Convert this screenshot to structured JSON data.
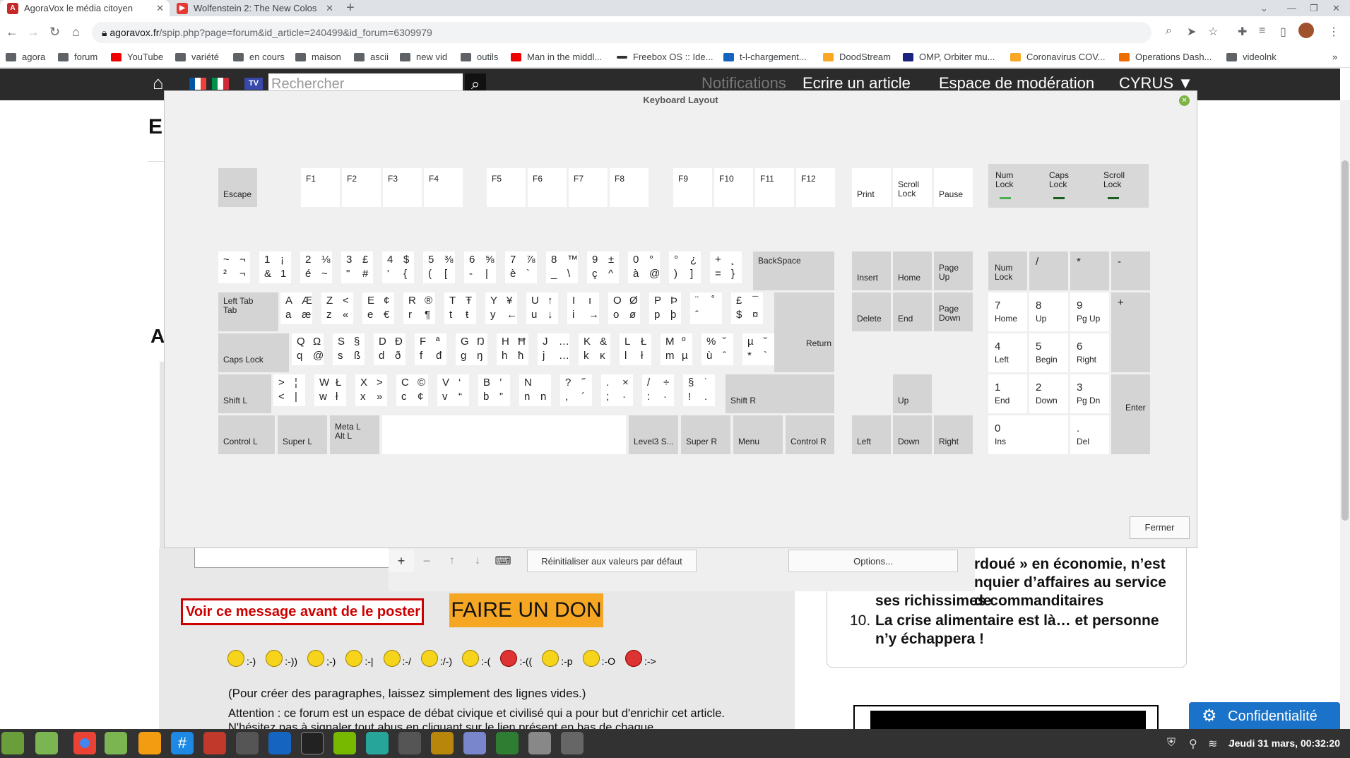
{
  "browser": {
    "tabs": [
      {
        "title": "AgoraVox le média citoyen",
        "close": "✕"
      },
      {
        "title": "Wolfenstein 2: The New Colos",
        "close": "✕"
      }
    ],
    "new_tab": "+",
    "window_controls": [
      "⌄",
      "—",
      "❐",
      "✕"
    ],
    "url_host": "agoravox.fr",
    "url_path": "/spip.php?page=forum&id_article=240499&id_forum=6309979",
    "bookmarks": [
      "agora",
      "forum",
      "YouTube",
      "variété",
      "en cours",
      "maison",
      "ascii",
      "new vid",
      "outils",
      "Man in the middl...",
      "Freebox OS :: Ide...",
      "t-l-chargement...",
      "DoodStream",
      "OMP, Orbiter mu...",
      "Coronavirus COV...",
      "Operations Dash...",
      "videolnk"
    ],
    "more_bookmarks": "»"
  },
  "site": {
    "search_placeholder": "Rechercher",
    "tv": "TV",
    "notifications": "Notifications",
    "ecrire": "Ecrire un article",
    "moderation": "Espace de modération",
    "user": "CYRUS ▼",
    "heading1": "Er",
    "heading2": "Aj",
    "voir": "Voir ce message avant de le poster",
    "don": "FAIRE UN DON",
    "smileys": [
      ":-)",
      ":-))",
      ";-)",
      ":-|",
      ":-/",
      ":/-)",
      ":-(",
      ":-((",
      ":-p",
      ":-O",
      ":->"
    ],
    "paragraph_hint": "(Pour créer des paragraphes, laissez simplement des lignes vides.)",
    "attention": "Attention : ce forum est un espace de débat civique et civilisé qui a pour but d'enrichir cet article. N'hésitez pas à signaler tout abus en cliquant sur le lien présent en bas de chaque",
    "right_panel": {
      "line1": "rdoué » en économie, n’est",
      "line2": "nquier d’affaires au service de",
      "line3": "ses richissimes commanditaires",
      "item10_num": "10.",
      "item10": "La crise alimentaire est là… et personne n’y échappera !"
    },
    "confidentialite": "Confidentialité"
  },
  "keyboard_bar": {
    "add": "+",
    "remove": "−",
    "up": "↑",
    "down": "↓",
    "reset": "Réinitialiser aux valeurs par défaut",
    "options": "Options..."
  },
  "dialog": {
    "title": "Keyboard Layout",
    "close": "Fermer",
    "fn_row": [
      "Escape",
      "F1",
      "F2",
      "F3",
      "F4",
      "F5",
      "F6",
      "F7",
      "F8",
      "F9",
      "F10",
      "F11",
      "F12"
    ],
    "sys_keys": [
      "Print",
      "Scroll\nLock",
      "Pause"
    ],
    "leds": [
      {
        "label": "Num\nLock",
        "color": "#4caf50"
      },
      {
        "label": "Caps\nLock",
        "color": "#1b5e20"
      },
      {
        "label": "Scroll\nLock",
        "color": "#1b5e20"
      }
    ],
    "row1": [
      [
        "~",
        "¬",
        "²",
        "¬"
      ],
      [
        "1",
        "¡",
        "&",
        "1"
      ],
      [
        "2",
        "⅛",
        "é",
        "~"
      ],
      [
        "3",
        "£",
        "\"",
        "#"
      ],
      [
        "4",
        "$",
        "'",
        "{"
      ],
      [
        "5",
        "⅜",
        "(",
        "["
      ],
      [
        "6",
        "⅝",
        "-",
        "|"
      ],
      [
        "7",
        "⅞",
        "è",
        "`"
      ],
      [
        "8",
        "™",
        "_",
        "\\"
      ],
      [
        "9",
        "±",
        "ç",
        "^"
      ],
      [
        "0",
        "°",
        "à",
        "@"
      ],
      [
        "°",
        "¿",
        ")",
        "]"
      ],
      [
        "+",
        "˛",
        "=",
        "}"
      ]
    ],
    "row2": [
      [
        "A",
        "Æ",
        "a",
        "æ"
      ],
      [
        "Z",
        "<",
        "z",
        "«"
      ],
      [
        "E",
        "¢",
        "e",
        "€"
      ],
      [
        "R",
        "®",
        "r",
        "¶"
      ],
      [
        "T",
        "Ŧ",
        "t",
        "ŧ"
      ],
      [
        "Y",
        "¥",
        "y",
        "←"
      ],
      [
        "U",
        "↑",
        "u",
        "↓"
      ],
      [
        "I",
        "ı",
        "i",
        "→"
      ],
      [
        "O",
        "Ø",
        "o",
        "ø"
      ],
      [
        "P",
        "Þ",
        "p",
        "þ"
      ],
      [
        "¨",
        "˚",
        "ˆ",
        ""
      ],
      [
        "£",
        "¯",
        "$",
        "¤"
      ]
    ],
    "row3": [
      [
        "Q",
        "Ω",
        "q",
        "@"
      ],
      [
        "S",
        "§",
        "s",
        "ß"
      ],
      [
        "D",
        "Ð",
        "d",
        "ð"
      ],
      [
        "F",
        "ª",
        "f",
        "đ"
      ],
      [
        "G",
        "Ŋ",
        "g",
        "ŋ"
      ],
      [
        "H",
        "Ħ",
        "h",
        "ħ"
      ],
      [
        "J",
        "…",
        "j",
        "…"
      ],
      [
        "K",
        "&",
        "k",
        "ĸ"
      ],
      [
        "L",
        "Ł",
        "l",
        "ł"
      ],
      [
        "M",
        "º",
        "m",
        "µ"
      ],
      [
        "%",
        "˘",
        "ù",
        "ˆ"
      ],
      [
        "µ",
        "˘",
        "*",
        "`"
      ]
    ],
    "row4": [
      [
        ">",
        "¦",
        "<",
        "|"
      ],
      [
        "W",
        "Ł",
        "w",
        "ł"
      ],
      [
        "X",
        ">",
        "x",
        "»"
      ],
      [
        "C",
        "©",
        "c",
        "¢"
      ],
      [
        "V",
        "‘",
        "v",
        "“"
      ],
      [
        "B",
        "’",
        "b",
        "”"
      ],
      [
        "N",
        "",
        "n",
        "n"
      ],
      [
        "?",
        "˝",
        ",",
        "´"
      ],
      [
        ".",
        "×",
        ";",
        "·"
      ],
      [
        "/",
        "÷",
        ":",
        "·"
      ],
      [
        "§",
        "˙",
        "!",
        "."
      ]
    ],
    "mods": {
      "backspace": "BackSpace",
      "tab": "Left Tab\nTab",
      "return": "Return",
      "caps": "Caps Lock",
      "shift_l": "Shift L",
      "shift_r": "Shift R",
      "ctrl_l": "Control L",
      "super_l": "Super L",
      "meta": "Meta L\nAlt L",
      "level3": "Level3 S...",
      "super_r": "Super R",
      "menu": "Menu",
      "ctrl_r": "Control R"
    },
    "nav": [
      "Insert",
      "Home",
      "Page\nUp",
      "Delete",
      "End",
      "Page\nDown",
      "Up",
      "Left",
      "Down",
      "Right"
    ],
    "numpad": [
      [
        "Num\nLock"
      ],
      [
        "/"
      ],
      [
        "*"
      ],
      [
        "-"
      ],
      [
        "7",
        "Home"
      ],
      [
        "8",
        "Up"
      ],
      [
        "9",
        "Pg Up"
      ],
      [
        "+"
      ],
      [
        "4",
        "Left"
      ],
      [
        "5",
        "Begin"
      ],
      [
        "6",
        "Right"
      ],
      [
        "1",
        "End"
      ],
      [
        "2",
        "Down"
      ],
      [
        "3",
        "Pg Dn"
      ],
      [
        "Enter"
      ],
      [
        "0",
        "Ins"
      ],
      [
        ".",
        "Del"
      ]
    ]
  },
  "taskbar": {
    "clock": "Jeudi 31 mars, 00:32:20"
  }
}
